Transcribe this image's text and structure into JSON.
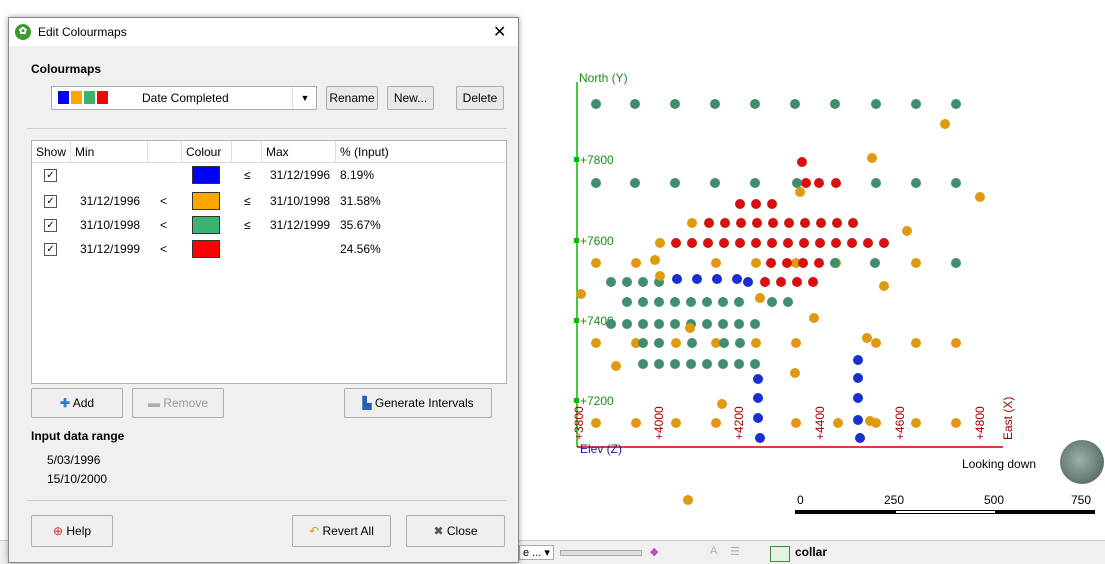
{
  "dialog": {
    "title": "Edit Colourmaps",
    "close_glyph": "✕",
    "colourmaps_label": "Colourmaps",
    "selected_colourmap": "Date Completed",
    "combo_swatch_colors": [
      "#0000ff",
      "#ffa500",
      "#3cb371",
      "#ff0000"
    ],
    "buttons": {
      "rename": "Rename",
      "new": "New...",
      "delete": "Delete"
    },
    "table": {
      "headers": [
        "Show",
        "Min",
        "",
        "Colour",
        "",
        "Max",
        "% (Input)"
      ],
      "rows": [
        {
          "show": "✓",
          "min": "",
          "min_op": "",
          "color": "#0000ff",
          "max_op": "≤",
          "max": "31/12/1996",
          "pct": "8.19%"
        },
        {
          "show": "✓",
          "min": "31/12/1996",
          "min_op": "<",
          "color": "#ffa500",
          "max_op": "≤",
          "max": "31/10/1998",
          "pct": "31.58%"
        },
        {
          "show": "✓",
          "min": "31/10/1998",
          "min_op": "<",
          "color": "#3cb371",
          "max_op": "≤",
          "max": "31/12/1999",
          "pct": "35.67%"
        },
        {
          "show": "✓",
          "min": "31/12/1999",
          "min_op": "<",
          "color": "#ff0000",
          "max_op": "",
          "max": "",
          "pct": "24.56%"
        }
      ]
    },
    "add": "Add",
    "remove": "Remove",
    "generate_intervals": "Generate Intervals",
    "input_data_range_label": "Input data range",
    "range_min": "5/03/1996",
    "range_max": "15/10/2000",
    "help": "Help",
    "revert_all": "Revert All",
    "close": "Close"
  },
  "scene": {
    "north_axis_label": "North (Y)",
    "east_axis_label": "East (X)",
    "elev_label": "Elev (Z)",
    "north_ticks": [
      "+7800",
      "+7600",
      "+7400",
      "+7200"
    ],
    "east_ticks": [
      "+3800",
      "+4000",
      "+4200",
      "+4400",
      "+4600",
      "+4800"
    ],
    "looking": "Looking down",
    "scale_labels": [
      "0",
      "250",
      "500",
      "750"
    ],
    "collar": "collar",
    "toolbar_dropdown": "e ...",
    "axis_color": "#00bb00",
    "east_axis_color": "#cc0000",
    "elev_color": "#1a1aa0"
  }
}
